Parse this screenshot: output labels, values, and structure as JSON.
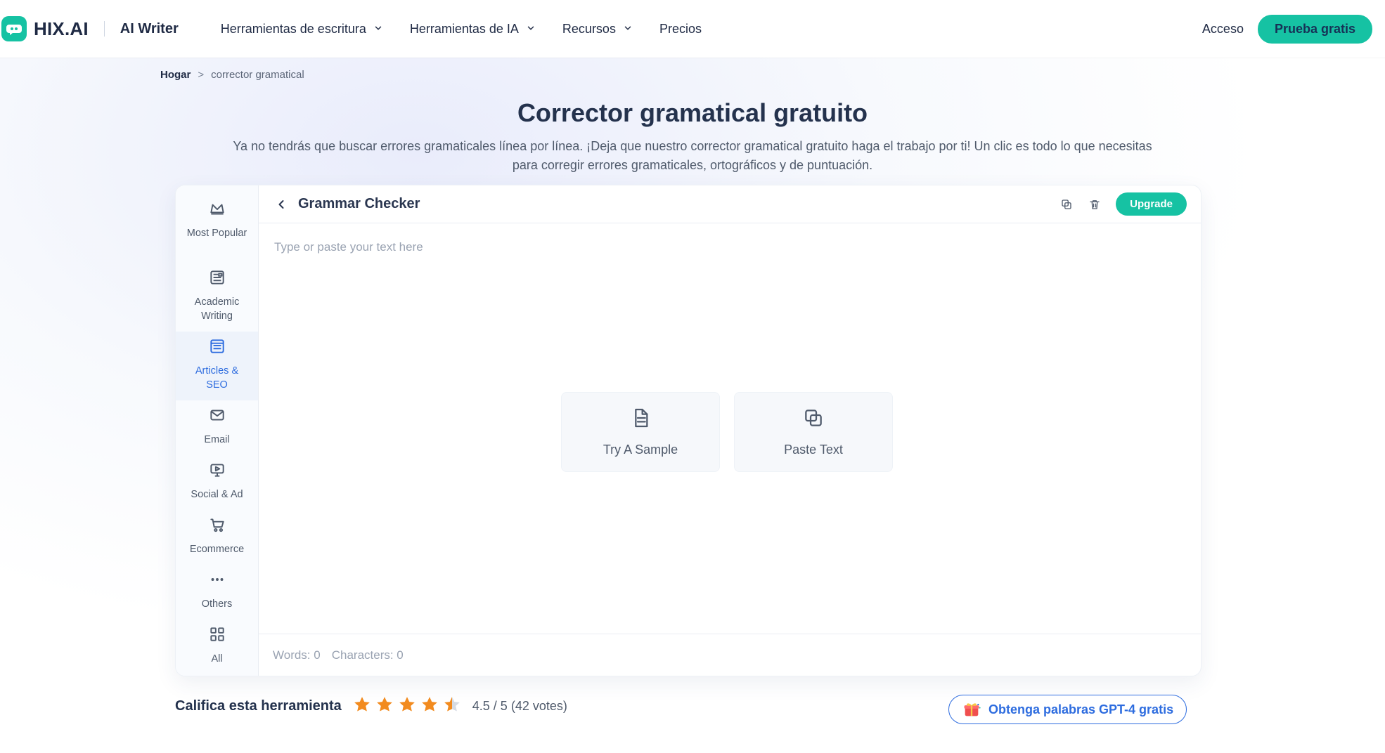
{
  "header": {
    "brand": "HIX.AI",
    "product": "AI Writer",
    "nav": [
      {
        "label": "Herramientas de escritura",
        "has_dropdown": true
      },
      {
        "label": "Herramientas de IA",
        "has_dropdown": true
      },
      {
        "label": "Recursos",
        "has_dropdown": true
      },
      {
        "label": "Precios",
        "has_dropdown": false
      }
    ],
    "login_label": "Acceso",
    "trial_label": "Prueba gratis"
  },
  "breadcrumb": {
    "home": "Hogar",
    "separator": ">",
    "current": "corrector gramatical"
  },
  "page": {
    "title": "Corrector gramatical gratuito",
    "subtitle": "Ya no tendrás que buscar errores gramaticales línea por línea. ¡Deja que nuestro corrector gramatical gratuito haga el trabajo por ti! Un clic es todo lo que necesitas para corregir errores gramaticales, ortográficos y de puntuación."
  },
  "tool": {
    "title": "Grammar Checker",
    "upgrade_label": "Upgrade",
    "editor_placeholder": "Type or paste your text here",
    "actions": {
      "sample": "Try A Sample",
      "paste": "Paste Text"
    },
    "footer": {
      "words": "Words: 0",
      "characters": "Characters: 0"
    },
    "sidebar": [
      {
        "label": "Most Popular",
        "icon": "crown-icon",
        "active": false
      },
      {
        "label": "Academic Writing",
        "icon": "academic-icon",
        "active": false
      },
      {
        "label": "Articles & SEO",
        "icon": "articles-icon",
        "active": true
      },
      {
        "label": "Email",
        "icon": "email-icon",
        "active": false
      },
      {
        "label": "Social & Ad",
        "icon": "social-icon",
        "active": false
      },
      {
        "label": "Ecommerce",
        "icon": "cart-icon",
        "active": false
      },
      {
        "label": "Others",
        "icon": "ellipsis-icon",
        "active": false
      },
      {
        "label": "All",
        "icon": "grid-icon",
        "active": false
      }
    ]
  },
  "rating": {
    "title": "Califica esta herramienta",
    "score": 4.5,
    "max": 5,
    "text": "4.5 / 5 (42 votes)"
  },
  "promo": {
    "label": "Obtenga palabras GPT-4 gratis"
  },
  "colors": {
    "accent": "#16c2a3",
    "blue": "#2d6cdf",
    "star": "#f28b1f"
  }
}
